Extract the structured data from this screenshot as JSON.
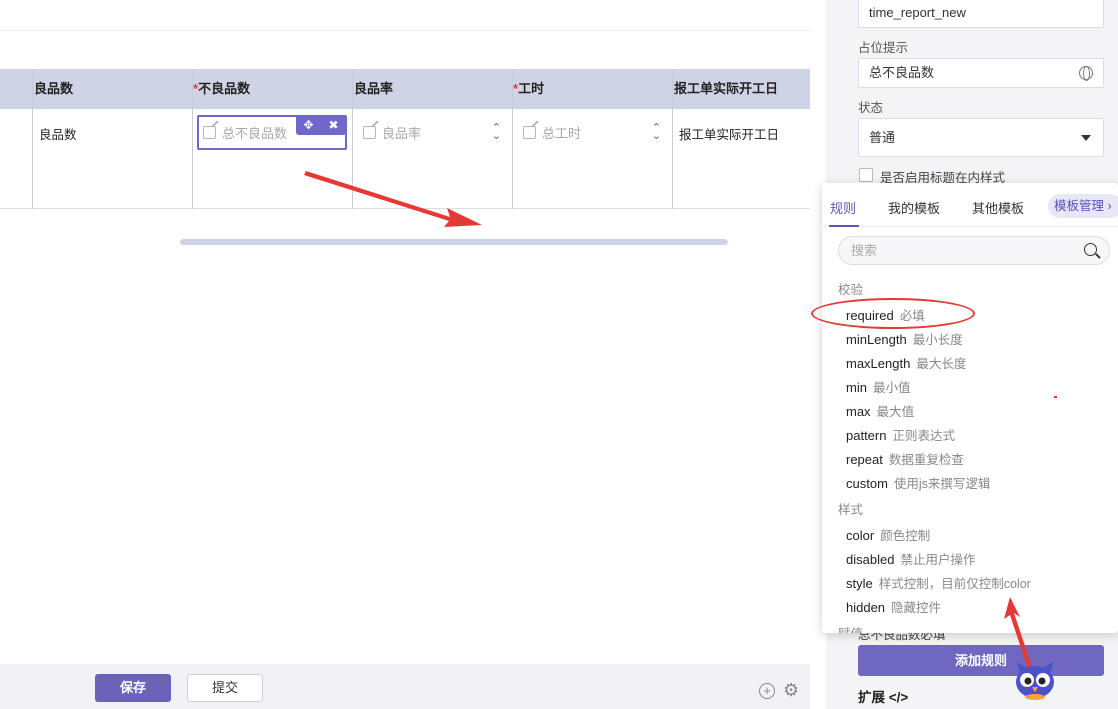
{
  "canvas": {
    "table": {
      "headers": [
        {
          "label": "良品数",
          "required": false
        },
        {
          "label": "不良品数",
          "required": true
        },
        {
          "label": "良品率",
          "required": false
        },
        {
          "label": "工时",
          "required": true
        },
        {
          "label": "报工单实际开工日",
          "required": false
        }
      ],
      "required_mark": "*",
      "cells": {
        "good_qty": "良品数",
        "bad_qty_placeholder": "总不良品数",
        "yield_placeholder": "良品率",
        "hours_placeholder": "总工时",
        "start_date": "报工单实际开工日"
      },
      "cell_tools": {
        "move": "✥",
        "close": "✖"
      }
    },
    "footer": {
      "save_label": "保存",
      "submit_label": "提交"
    },
    "icons": {
      "add": "plus-circle-icon",
      "settings": "gear-icon"
    }
  },
  "properties": {
    "name_value": "time_report_new",
    "placeholder_label": "占位提示",
    "placeholder_value": "总不良品数",
    "status_label": "状态",
    "status_value": "普通",
    "inline_title_label": "是否启用标题在内样式",
    "hidden_rule_text": "总不良品数必填",
    "add_rule_label": "添加规则",
    "extend_label": "扩展 </>"
  },
  "rule_popover": {
    "tabs": [
      "规则",
      "我的模板",
      "其他模板"
    ],
    "active_tab": 0,
    "template_manage_label": "模板管理 ›",
    "search_placeholder": "搜索",
    "groups": [
      {
        "title": "校验",
        "rules": [
          {
            "key": "required",
            "desc": "必填"
          },
          {
            "key": "minLength",
            "desc": "最小长度"
          },
          {
            "key": "maxLength",
            "desc": "最大长度"
          },
          {
            "key": "min",
            "desc": "最小值"
          },
          {
            "key": "max",
            "desc": "最大值"
          },
          {
            "key": "pattern",
            "desc": "正则表达式"
          },
          {
            "key": "repeat",
            "desc": "数据重复检查"
          },
          {
            "key": "custom",
            "desc": "使用js来撰写逻辑"
          }
        ]
      },
      {
        "title": "样式",
        "rules": [
          {
            "key": "color",
            "desc": "颜色控制"
          },
          {
            "key": "disabled",
            "desc": "禁止用户操作"
          },
          {
            "key": "style",
            "desc": "样式控制，目前仅控制color"
          },
          {
            "key": "hidden",
            "desc": "隐藏控件"
          }
        ]
      },
      {
        "title": "赋值",
        "rules": []
      }
    ]
  },
  "colors": {
    "accent": "#6f67c0",
    "header_bg": "#cfd3e6",
    "annotation_red": "#e53935"
  }
}
